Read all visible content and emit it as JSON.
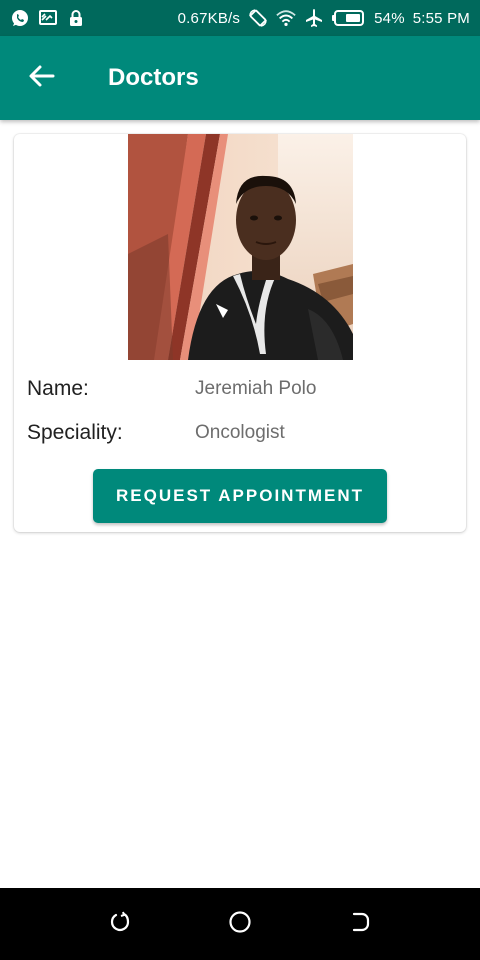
{
  "status_bar": {
    "net_speed": "0.67KB/s",
    "battery": "54%",
    "time": "5:55 PM",
    "icons": [
      "whatsapp-icon",
      "cast-icon",
      "lock-icon",
      "rotate-icon",
      "wifi-icon",
      "airplane-icon",
      "battery-icon"
    ]
  },
  "app_bar": {
    "title": "Doctors",
    "back_icon": "arrow-back-icon"
  },
  "doctor": {
    "name_label": "Name:",
    "name": "Jeremiah Polo",
    "speciality_label": "Speciality:",
    "speciality": "Oncologist",
    "button_label": "REQUEST APPOINTMENT"
  },
  "colors": {
    "status_bar": "#00695c",
    "primary": "#00897b",
    "nav_bar": "#000000"
  },
  "nav_bar": {
    "icons": [
      "recent-apps-icon",
      "home-icon",
      "back-nav-icon"
    ]
  }
}
